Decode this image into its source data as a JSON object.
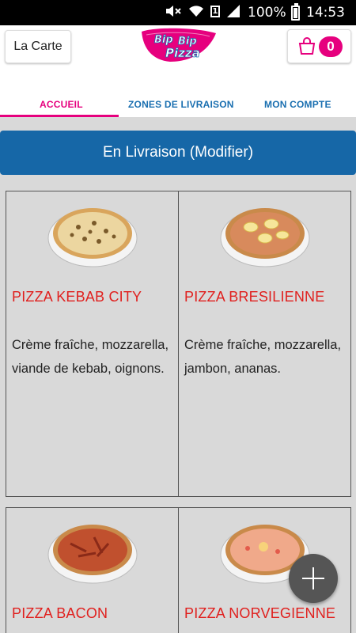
{
  "status_bar": {
    "battery": "100%",
    "time": "14:53",
    "sim": "1"
  },
  "header": {
    "carte_label": "La Carte",
    "cart_count": "0",
    "brand_color": "#e6007e"
  },
  "tabs": [
    {
      "label": "ACCUEIL",
      "active": true
    },
    {
      "label": "ZONES DE LIVRAISON",
      "active": false
    },
    {
      "label": "MON COMPTE",
      "active": false
    }
  ],
  "livraison_label": "En Livraison (Modifier)",
  "products": [
    {
      "name": "PIZZA KEBAB CITY",
      "description": "Crème fraîche, mozzarella, viande de kebab, oignons."
    },
    {
      "name": "PIZZA BRESILIENNE",
      "description": "Crème fraîche, mozzarella, jambon, ananas."
    },
    {
      "name": "PIZZA BACON",
      "description": ""
    },
    {
      "name": "PIZZA NORVEGIENNE",
      "description": ""
    }
  ]
}
